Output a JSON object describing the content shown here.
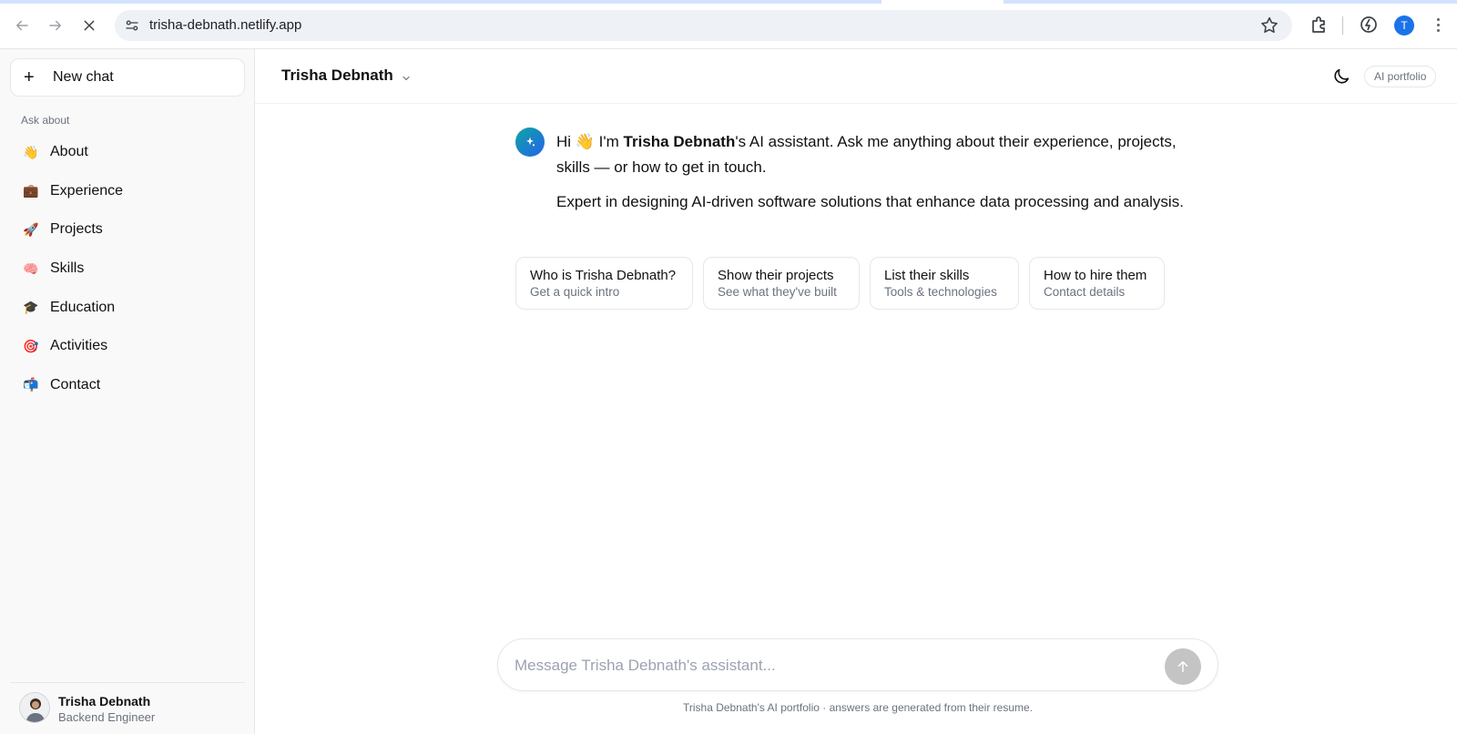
{
  "browser": {
    "url": "trisha-debnath.netlify.app",
    "profile_initial": "T"
  },
  "sidebar": {
    "new_chat_label": "New chat",
    "section_label": "Ask about",
    "items": [
      {
        "emoji": "👋",
        "label": "About"
      },
      {
        "emoji": "💼",
        "label": "Experience"
      },
      {
        "emoji": "🚀",
        "label": "Projects"
      },
      {
        "emoji": "🧠",
        "label": "Skills"
      },
      {
        "emoji": "🎓",
        "label": "Education"
      },
      {
        "emoji": "🎯",
        "label": "Activities"
      },
      {
        "emoji": "📬",
        "label": "Contact"
      }
    ],
    "user": {
      "name": "Trisha Debnath",
      "role": "Backend Engineer"
    }
  },
  "header": {
    "title": "Trisha Debnath",
    "badge": "AI portfolio"
  },
  "message": {
    "greeting_prefix": "Hi 👋 I'm ",
    "greeting_name": "Trisha Debnath",
    "greeting_suffix": "'s AI assistant. Ask me anything about their experience, projects, skills — or how to get in touch.",
    "tagline": "Expert in designing AI-driven software solutions that enhance data processing and analysis."
  },
  "suggestions": [
    {
      "title": "Who is Trisha Debnath?",
      "subtitle": "Get a quick intro"
    },
    {
      "title": "Show their projects",
      "subtitle": "See what they've built"
    },
    {
      "title": "List their skills",
      "subtitle": "Tools & technologies"
    },
    {
      "title": "How to hire them",
      "subtitle": "Contact details"
    }
  ],
  "composer": {
    "placeholder": "Message Trisha Debnath's assistant...",
    "footnote": "Trisha Debnath's AI portfolio · answers are generated from their resume."
  },
  "colors": {
    "accent_gradient_start": "#0ea5a4",
    "accent_gradient_end": "#2563eb",
    "send_button_disabled": "#c4c4c4"
  }
}
